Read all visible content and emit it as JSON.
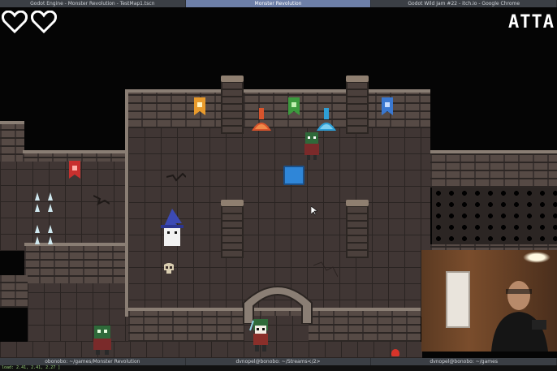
{
  "taskbar_top": {
    "tabs": [
      {
        "label": "Godot Engine - Monster Revolution - TestMap1.tscn",
        "active": false
      },
      {
        "label": "Monster Revolution",
        "active": true
      },
      {
        "label": "Godot Wild Jam #22 - itch.io - Google Chrome",
        "active": false
      }
    ]
  },
  "hud": {
    "hearts": 2,
    "attack_label": "ATTA"
  },
  "taskbar_bottom": {
    "tabs": [
      {
        "label": "obonobo: ~/games/Monster Revolution"
      },
      {
        "label": "dvnopel@bonobo: ~/Streams</2>"
      },
      {
        "label": "dvnopel@bonobo: ~/games"
      }
    ]
  },
  "status_line": "load: 2.41, 2.41, 2.27 ]",
  "colors": {
    "floor": "#403634",
    "wall": "#564a45",
    "banner_orange": "#e89a2c",
    "banner_green": "#3c9a3e",
    "banner_blue": "#3a78d0",
    "banner_red": "#c8302e",
    "potion_red": "#d8542c",
    "potion_blue": "#2e9fd6",
    "player_hat": "#3c4ab4"
  },
  "icons": [
    "heart-outline-icon",
    "banner-icon",
    "potion-icon",
    "skull-icon",
    "mouse-cursor-icon"
  ]
}
